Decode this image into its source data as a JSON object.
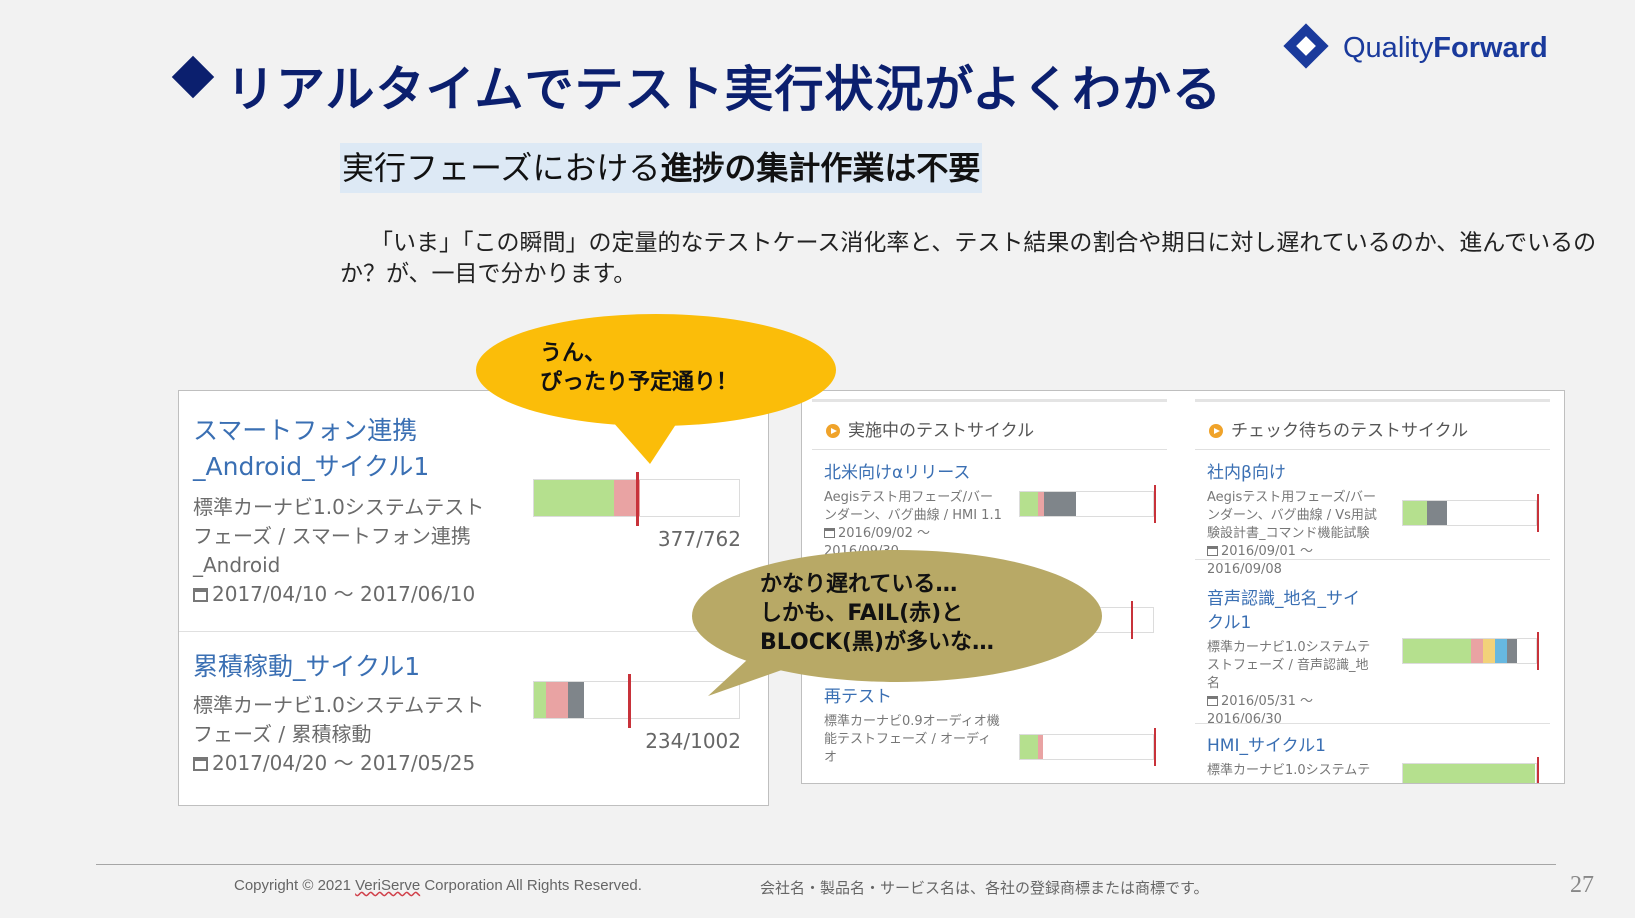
{
  "header": {
    "title": "リアルタイムでテスト実行状況がよくわかる",
    "logo_light": "Quality",
    "logo_bold": "Forward",
    "subtitle_plain": "実行フェーズにおける",
    "subtitle_bold": "進捗の集計作業は不要",
    "description": "「いま」「この瞬間」の定量的なテストケース消化率と、テスト結果の割合や期日に対し遅れているのか、進んでいるのか？が、一目で分かります。"
  },
  "left_cards": [
    {
      "title": "スマートフォン連携_Android_サイクル1",
      "meta": "標準カーナビ1.0システムテストフェーズ / スマートフォン連携_Android",
      "dates": "2017/04/10 〜 2017/06/10",
      "count": "377/762"
    },
    {
      "title": "累積稼動_サイクル1",
      "meta": "標準カーナビ1.0システムテストフェーズ / 累積稼動",
      "dates": "2017/04/20 〜 2017/05/25",
      "count": "234/1002"
    }
  ],
  "right_panel": {
    "col1_header": "実施中のテストサイクル",
    "col2_header": "チェック待ちのテストサイクル",
    "col1_items": [
      {
        "title": "北米向けαリリース",
        "meta": "Aegisテスト用フェーズ/バーンダーン、バグ曲線 / HMI 1.1",
        "dates": "2016/09/02 〜 2016/09/30"
      },
      {
        "title": "再テスト",
        "meta": "標準カーナビ0.9オーディオ機能テストフェーズ / オーディオ",
        "dates": ""
      }
    ],
    "col2_items": [
      {
        "title": "社内β向け",
        "meta": "Aegisテスト用フェーズ/バーンダーン、バグ曲線 / Vs用試験設計書_コマンド機能試験",
        "dates": "2016/09/01 〜 2016/09/08"
      },
      {
        "title": "音声認識_地名_サイクル1",
        "meta": "標準カーナビ1.0システムテストフェーズ / 音声認識_地名",
        "dates": "2016/05/31 〜 2016/06/30"
      },
      {
        "title": "HMI_サイクル1",
        "meta": "標準カーナビ1.0システムテ",
        "dates": ""
      }
    ]
  },
  "bubbles": {
    "yellow_line1": "うん、",
    "yellow_line2": "ぴったり予定通り！",
    "olive_line1": "かなり遅れている…",
    "olive_line2": "しかも、FAIL(赤)と",
    "olive_line3": "BLOCK(黒)が多いな…"
  },
  "footer": {
    "copyright_pre": "Copyright © 2021 ",
    "copyright_company": "VeriServe",
    "copyright_post": " Corporation All Rights Reserved.",
    "trademark": "会社名・製品名・サービス名は、各社の登録商標または商標です。",
    "page_number": "27"
  },
  "colors": {
    "title": "#0b1f6e",
    "link": "#3a6fb3",
    "pass": "#b5e08e",
    "fail": "#e9a3a3",
    "block": "#7f858a",
    "deadline": "#c8323a",
    "yellow_bubble": "#fbbd09",
    "olive_bubble": "#b8a966"
  }
}
